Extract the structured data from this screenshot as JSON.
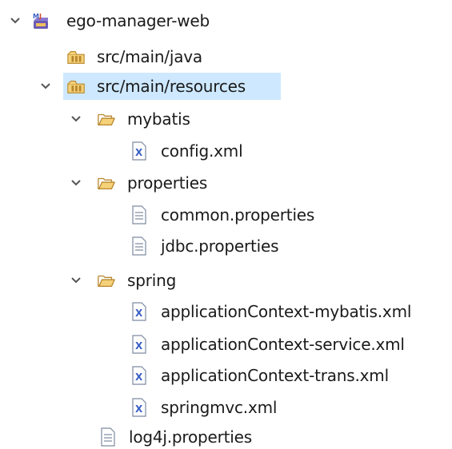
{
  "tree": {
    "project": {
      "label": "ego-manager-web",
      "icon": "maven-project-icon",
      "expanded": true
    },
    "items": [
      {
        "label": "src/main/java",
        "icon": "source-folder-icon",
        "expanded": false,
        "has_toggle": false
      },
      {
        "label": "src/main/resources",
        "icon": "source-folder-icon",
        "expanded": true,
        "selected": true
      },
      {
        "label": "mybatis",
        "icon": "folder-open-icon",
        "expanded": true
      },
      {
        "label": "config.xml",
        "icon": "xml-file-icon"
      },
      {
        "label": "properties",
        "icon": "folder-open-icon",
        "expanded": true
      },
      {
        "label": "common.properties",
        "icon": "text-file-icon"
      },
      {
        "label": "jdbc.properties",
        "icon": "text-file-icon"
      },
      {
        "label": "spring",
        "icon": "folder-open-icon",
        "expanded": true
      },
      {
        "label": "applicationContext-mybatis.xml",
        "icon": "xml-file-icon"
      },
      {
        "label": "applicationContext-service.xml",
        "icon": "xml-file-icon"
      },
      {
        "label": "applicationContext-trans.xml",
        "icon": "xml-file-icon"
      },
      {
        "label": "springmvc.xml",
        "icon": "xml-file-icon"
      },
      {
        "label": "log4j.properties",
        "icon": "text-file-icon"
      }
    ]
  },
  "colors": {
    "selection": "#cde8ff",
    "folder": "#f0c060",
    "text": "#1a1a1a"
  }
}
